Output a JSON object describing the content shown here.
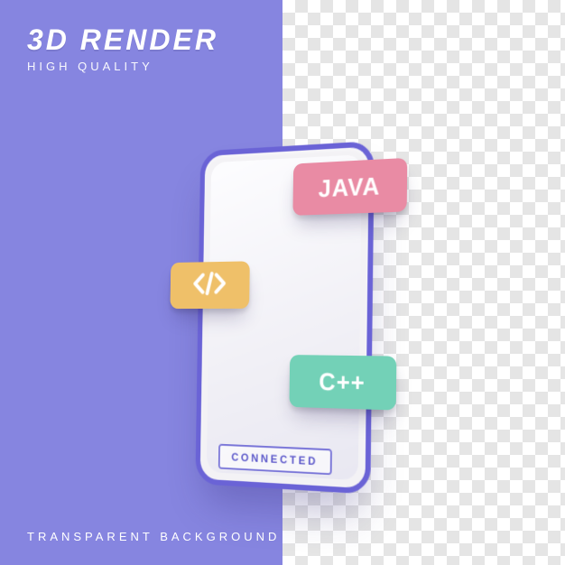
{
  "header": {
    "title": "3D RENDER",
    "subtitle": "HIGH QUALITY"
  },
  "footer": {
    "text": "TRANSPARENT BACKGROUND"
  },
  "badges": {
    "java": "JAVA",
    "cpp": "C++",
    "code_icon": "code-icon"
  },
  "phone": {
    "status": "CONNECTED"
  },
  "colors": {
    "purple_bg": "#8685e0",
    "phone_frame": "#6a63d6",
    "java_badge": "#e98ba4",
    "code_badge": "#efc069",
    "cpp_badge": "#73d1b7"
  }
}
